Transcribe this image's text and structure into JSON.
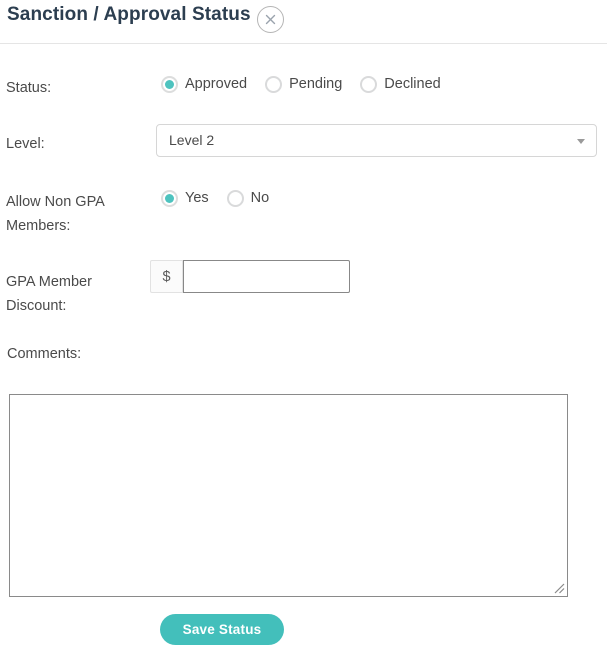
{
  "header": {
    "title": "Sanction / Approval Status",
    "close_icon": "close-circle-icon"
  },
  "form": {
    "status": {
      "label": "Status:",
      "options": [
        {
          "label": "Approved",
          "checked": true
        },
        {
          "label": "Pending",
          "checked": false
        },
        {
          "label": "Declined",
          "checked": false
        }
      ]
    },
    "level": {
      "label": "Level:",
      "selected": "Level 2",
      "caret_icon": "chevron-down-icon"
    },
    "allow_non_gpa": {
      "label": "Allow Non GPA Members:",
      "label_line1": "Allow Non GPA",
      "label_line2": "Members:",
      "options": [
        {
          "label": "Yes",
          "checked": true
        },
        {
          "label": "No",
          "checked": false
        }
      ]
    },
    "gpa_discount": {
      "label_line1": "GPA Member",
      "label_line2": "Discount:",
      "currency_symbol": "$",
      "value": "",
      "placeholder": ""
    },
    "comments": {
      "label": "Comments:",
      "value": "",
      "placeholder": ""
    }
  },
  "actions": {
    "save_label": "Save Status"
  },
  "colors": {
    "accent": "#43bfbb",
    "radio_accent": "#4ec3bf",
    "title": "#2c3e50",
    "label": "#4a4a4a",
    "border": "#d6d6d6"
  }
}
